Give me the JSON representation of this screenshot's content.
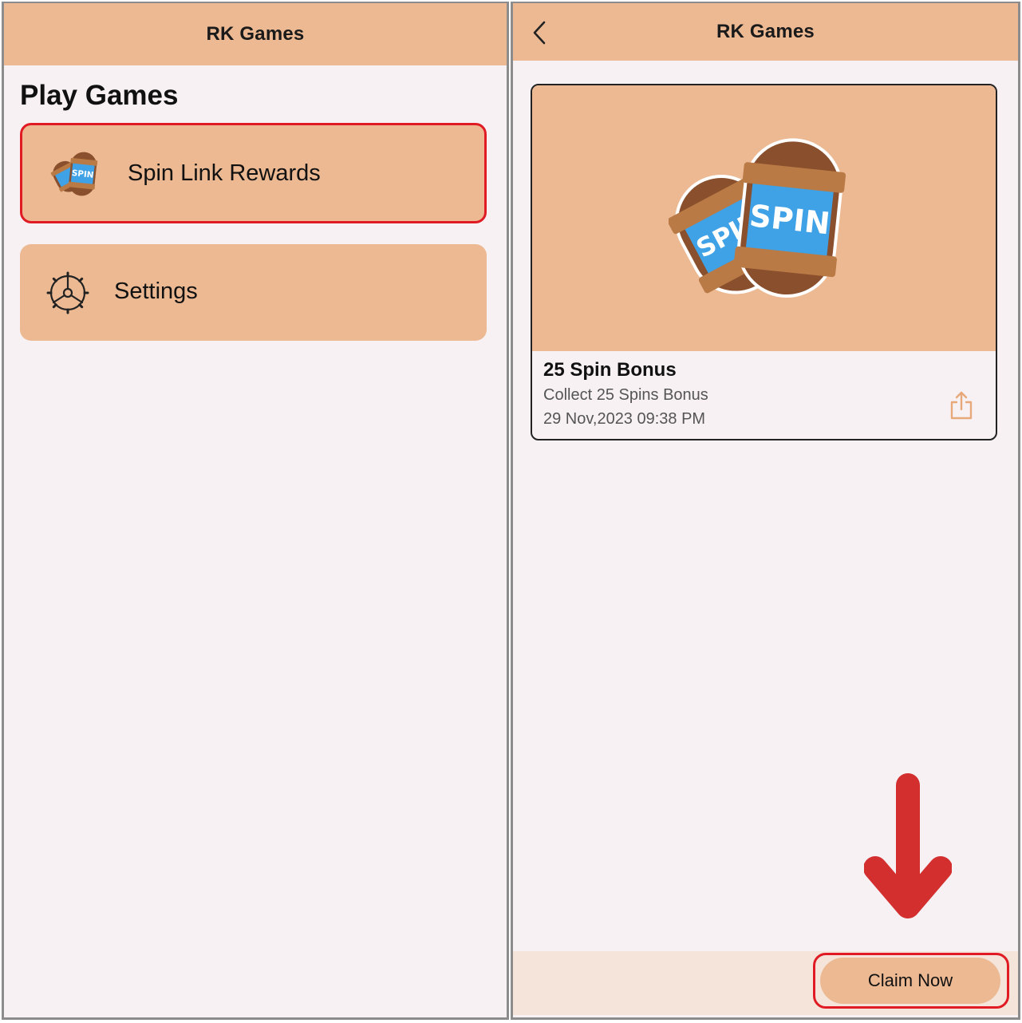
{
  "left_screen": {
    "header": {
      "title": "RK Games"
    },
    "section_title": "Play Games",
    "menu": [
      {
        "label": "Spin Link Rewards",
        "icon": "spin-capsules-icon",
        "highlighted": true
      },
      {
        "label": "Settings",
        "icon": "gear-icon",
        "highlighted": false
      }
    ]
  },
  "right_screen": {
    "header": {
      "title": "RK Games",
      "back_icon": "chevron-left-icon"
    },
    "reward_card": {
      "title": "25 Spin Bonus",
      "description": "Collect 25 Spins Bonus",
      "date": "29 Nov,2023 09:38 PM",
      "image_text": "SPIN",
      "share_icon": "share-icon"
    },
    "annotation": {
      "icon": "arrow-down-icon",
      "color": "#d32f2f"
    },
    "claim_button": {
      "label": "Claim Now",
      "outline_color": "#e01b24"
    }
  },
  "colors": {
    "header_bg": "#ecb993",
    "page_bg": "#f7f1f4",
    "highlight": "#e01b24",
    "capsule_blue": "#3fa1e6",
    "capsule_brown": "#8a4f2c"
  }
}
